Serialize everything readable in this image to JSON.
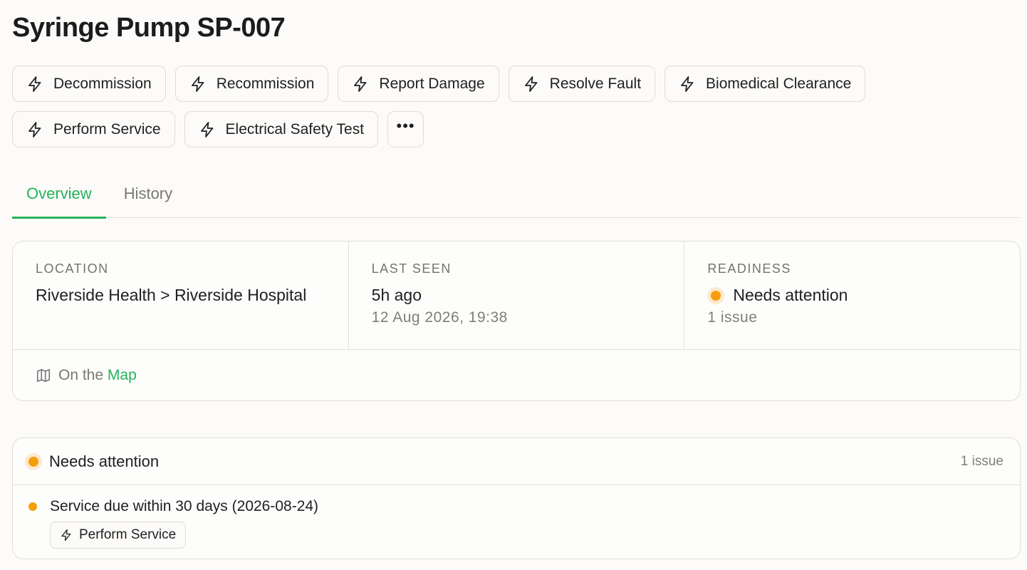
{
  "page": {
    "title": "Syringe Pump SP-007"
  },
  "actions": {
    "row1": [
      {
        "label": "Decommission",
        "icon": "lightning-icon"
      },
      {
        "label": "Recommission",
        "icon": "lightning-icon"
      },
      {
        "label": "Report Damage",
        "icon": "lightning-icon"
      },
      {
        "label": "Resolve Fault",
        "icon": "lightning-icon"
      },
      {
        "label": "Biomedical Clearance",
        "icon": "lightning-icon"
      }
    ],
    "row2": [
      {
        "label": "Perform Service",
        "icon": "lightning-icon"
      },
      {
        "label": "Electrical Safety Test",
        "icon": "lightning-icon"
      }
    ],
    "more_label": "•••"
  },
  "tabs": [
    {
      "label": "Overview",
      "active": true
    },
    {
      "label": "History",
      "active": false
    }
  ],
  "summary": {
    "location": {
      "label": "LOCATION",
      "value": "Riverside Health > Riverside Hospital"
    },
    "last_seen": {
      "label": "LAST SEEN",
      "value": "5h ago",
      "sub": "12 Aug 2026, 19:38"
    },
    "readiness": {
      "label": "READINESS",
      "value": "Needs attention",
      "sub": "1 issue",
      "status_color": "#f59e0b"
    },
    "map": {
      "prefix": "On the ",
      "link": "Map",
      "icon": "map-icon"
    }
  },
  "issues": {
    "title": "Needs attention",
    "count": "1 issue",
    "items": [
      {
        "text": "Service due within 30 days (2026-08-24)",
        "action_label": "Perform Service"
      }
    ]
  },
  "colors": {
    "accent": "#25b35a",
    "warning": "#f59e0b",
    "border": "#e0deda"
  }
}
